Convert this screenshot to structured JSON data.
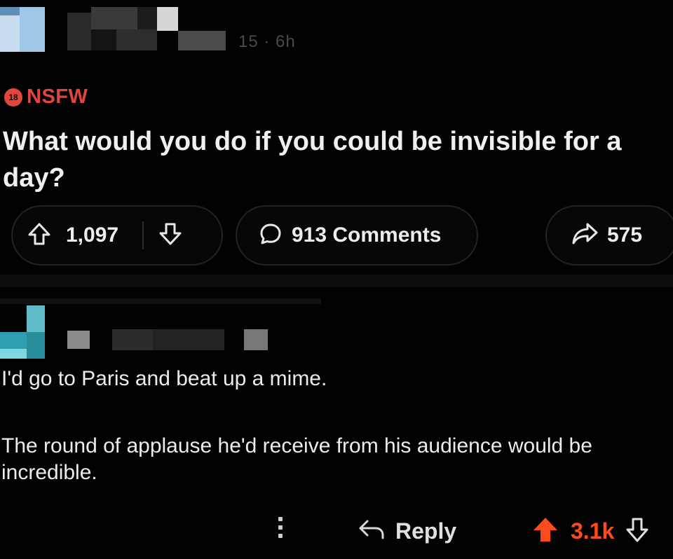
{
  "post": {
    "meta": "15 · 6h",
    "badge_text": "18",
    "nsfw_label": "NSFW",
    "title": "What would you do if you could be invisible for a day?",
    "upvotes": "1,097",
    "comments_label": "913 Comments",
    "shares": "575"
  },
  "comment": {
    "line1": "I'd go to Paris and beat up a mime.",
    "line2": "The round of applause he'd receive from his audience would be incredible.",
    "reply_label": "Reply",
    "score": "3.1k"
  },
  "colors": {
    "background": "#020202",
    "nsfw": "#e2453c",
    "upvoted": "#ff4a1c",
    "text": "#e8e8e8"
  },
  "icons": [
    "upvote-icon",
    "downvote-icon",
    "comment-bubble-icon",
    "share-icon",
    "more-options-icon",
    "reply-icon",
    "upvoted-icon"
  ]
}
